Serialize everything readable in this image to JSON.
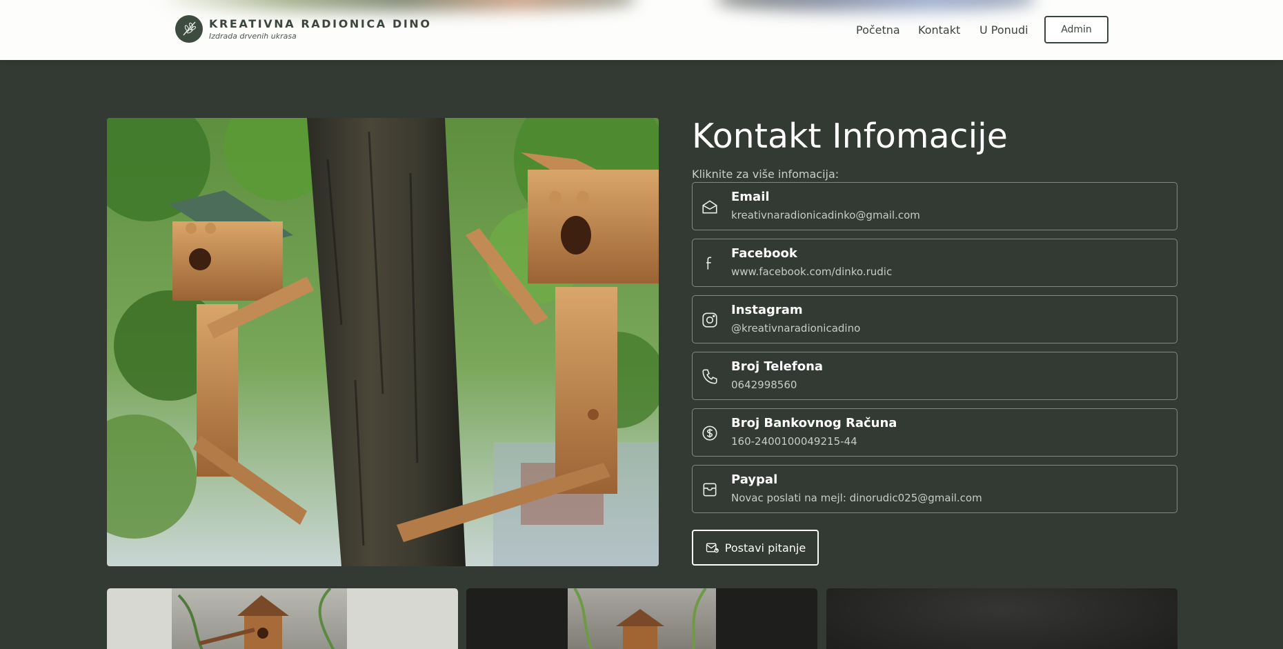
{
  "brand": {
    "title": "KREATIVNA RADIONICA DINO",
    "subtitle": "Izdrada drvenih ukrasa"
  },
  "nav": {
    "items": [
      {
        "label": "Početna"
      },
      {
        "label": "Kontakt"
      },
      {
        "label": "U Ponudi"
      }
    ],
    "admin_label": "Admin"
  },
  "contact": {
    "title": "Kontakt Infomacije",
    "subtitle": "Kliknite za više infomacija:",
    "items": [
      {
        "icon": "mail-open-icon",
        "label": "Email",
        "value": "kreativnaradionicadinko@gmail.com"
      },
      {
        "icon": "facebook-icon",
        "label": "Facebook",
        "value": "www.facebook.com/dinko.rudic"
      },
      {
        "icon": "instagram-icon",
        "label": "Instagram",
        "value": "@kreativnaradionicadino"
      },
      {
        "icon": "phone-icon",
        "label": "Broj Telefona",
        "value": "0642998560"
      },
      {
        "icon": "dollar-icon",
        "label": "Broj Bankovnog Računa",
        "value": "160-2400100049215-44"
      },
      {
        "icon": "wallet-icon",
        "label": "Paypal",
        "value": "Novac poslati na mejl: dinorudic025@gmail.com"
      }
    ],
    "ask_label": "Postavi pitanje"
  },
  "colors": {
    "background": "#323a33",
    "header": "#fdfdfc",
    "text_light": "#ffffff",
    "border": "#848a84"
  }
}
